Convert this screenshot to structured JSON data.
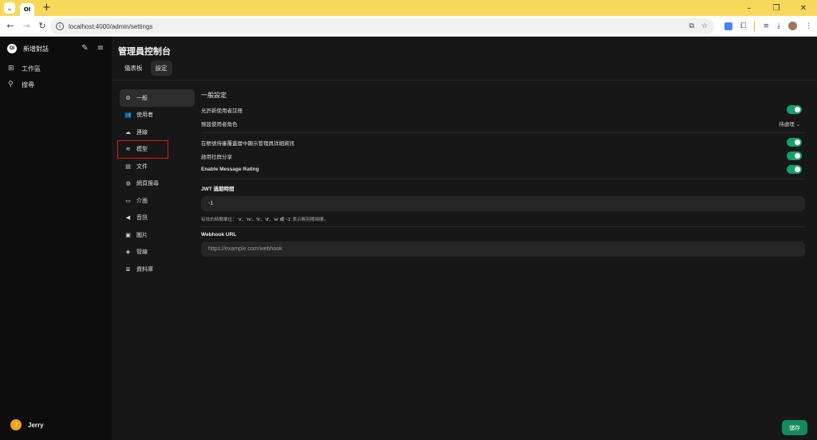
{
  "browser": {
    "tab_logo": "OI",
    "new_tab": "+",
    "url": "localhost:4000/admin/settings"
  },
  "sidebar": {
    "logo": "OI",
    "title": "新增對話",
    "items": [
      {
        "label": "工作區",
        "icon": "grid-icon"
      },
      {
        "label": "搜尋",
        "icon": "search-icon"
      }
    ],
    "user": {
      "initial": "J",
      "name": "Jerry"
    }
  },
  "header": {
    "title": "管理員控制台",
    "tabs": [
      {
        "label": "儀表板",
        "active": false
      },
      {
        "label": "設定",
        "active": true
      }
    ]
  },
  "settings_nav": [
    {
      "label": "一般",
      "icon": "gear-icon",
      "active": true
    },
    {
      "label": "使用者",
      "icon": "users-icon"
    },
    {
      "label": "連線",
      "icon": "cloud-icon"
    },
    {
      "label": "模型",
      "icon": "stack-icon",
      "highlighted": true
    },
    {
      "label": "文件",
      "icon": "document-icon"
    },
    {
      "label": "網頁搜尋",
      "icon": "globe-icon"
    },
    {
      "label": "介面",
      "icon": "monitor-icon"
    },
    {
      "label": "音訊",
      "icon": "speaker-icon"
    },
    {
      "label": "圖片",
      "icon": "image-icon"
    },
    {
      "label": "管線",
      "icon": "pipeline-icon"
    },
    {
      "label": "資料庫",
      "icon": "database-icon"
    }
  ],
  "general": {
    "section_title": "一般設定",
    "allow_signup_label": "允許新使用者註冊",
    "allow_signup": true,
    "default_role_label": "預設使用者角色",
    "default_role_value": "待處理",
    "show_admin_label": "在帳號待審覆蓋層中顯示管理員詳細資訊",
    "show_admin": true,
    "community_share_label": "啟用社群分享",
    "community_share": true,
    "message_rating_label": "Enable Message Rating",
    "message_rating": true,
    "jwt_label": "JWT 過期時間",
    "jwt_value": "-1",
    "jwt_hint_prefix": "有效的時間單位：",
    "jwt_hint_units": "'s'、'm'、'h'、'd'、'w' 或 '-1'",
    "jwt_hint_suffix": "表示無到期時間。",
    "webhook_label": "Webhook URL",
    "webhook_placeholder": "https://example.com/webhook"
  },
  "save_label": "儲存",
  "colors": {
    "accent": "#16a06a",
    "highlight_border": "#e01b1b"
  }
}
